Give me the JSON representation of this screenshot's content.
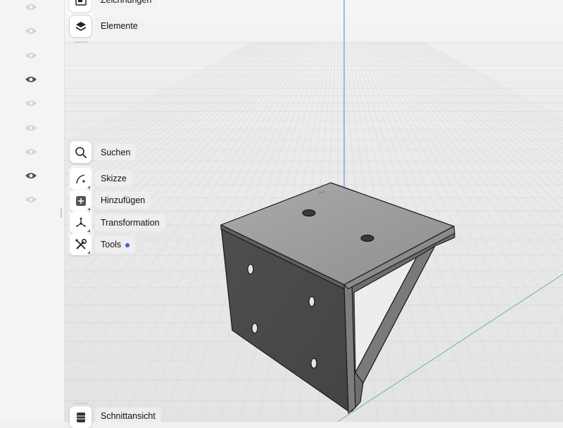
{
  "toolbar": {
    "zeichnungen_label": "Zeichnungen",
    "elemente_label": "Elemente",
    "suchen_label": "Suchen",
    "skizze_label": "Skizze",
    "hinzufuegen_label": "Hinzufügen",
    "transformation_label": "Transformation",
    "tools_label": "Tools",
    "schnittansicht_label": "Schnittansicht"
  },
  "visibility_column": {
    "rows": [
      {
        "state": "hidden"
      },
      {
        "state": "hidden"
      },
      {
        "state": "hidden"
      },
      {
        "state": "visible"
      },
      {
        "state": "hidden"
      },
      {
        "state": "hidden"
      },
      {
        "state": "hidden"
      },
      {
        "state": "visible"
      },
      {
        "state": "hidden"
      }
    ]
  },
  "icons": {
    "zeichnungen": "drawings-icon",
    "elemente": "layers-icon",
    "suchen": "search-icon",
    "skizze": "sketch-icon",
    "hinzufuegen": "add-icon",
    "transformation": "transform-icon",
    "tools": "tools-icon",
    "schnittansicht": "section-view-icon"
  },
  "colors": {
    "accent": "#2f63e0",
    "axis_y": "#4a80e6",
    "axis_x": "#6abf7c",
    "model_face_dark": "#4b4b4b",
    "model_face_top": "#9a9a9a",
    "grid": "#d6d6d6"
  }
}
